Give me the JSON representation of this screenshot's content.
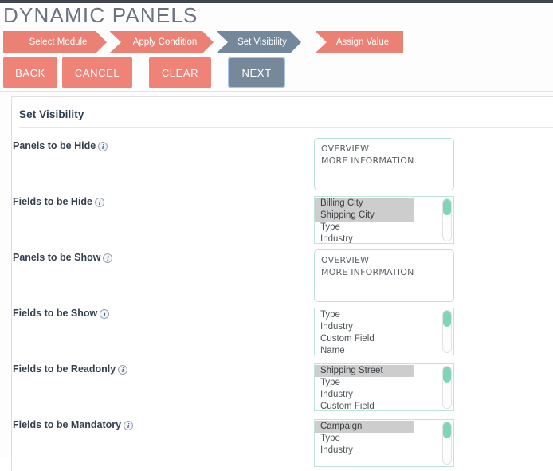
{
  "page": {
    "title": "DYNAMIC PANELS"
  },
  "wizard": {
    "steps": [
      {
        "label": "Select Module",
        "state": "done"
      },
      {
        "label": "Apply Condition",
        "state": "done"
      },
      {
        "label": "Set Visibility",
        "state": "active"
      },
      {
        "label": "Assign Value",
        "state": "todo"
      }
    ]
  },
  "toolbar": {
    "back_label": "BACK",
    "cancel_label": "CANCEL",
    "clear_label": "CLEAR",
    "next_label": "NEXT"
  },
  "card": {
    "title": "Set Visibility"
  },
  "fields": [
    {
      "label": "Panels to be Hide",
      "icon": "info-icon",
      "type": "panelbox",
      "options": [
        "OVERVIEW",
        "MORE INFORMATION"
      ],
      "selected": []
    },
    {
      "label": "Fields to be Hide",
      "icon": "info-icon",
      "type": "listbox",
      "options": [
        "Billing City",
        "Shipping City",
        "Type",
        "Industry"
      ],
      "selected": [
        "Billing City",
        "Shipping City"
      ]
    },
    {
      "label": "Panels to be Show",
      "icon": "info-icon",
      "type": "panelbox",
      "options": [
        "OVERVIEW",
        "MORE INFORMATION"
      ],
      "selected": []
    },
    {
      "label": "Fields to be Show",
      "icon": "info-icon",
      "type": "listbox",
      "options": [
        "Type",
        "Industry",
        "Custom Field",
        "Name"
      ],
      "selected": []
    },
    {
      "label": "Fields to be Readonly",
      "icon": "info-icon",
      "type": "listbox",
      "options": [
        "Shipping Street",
        "Type",
        "Industry",
        "Custom Field"
      ],
      "selected": [
        "Shipping Street"
      ]
    },
    {
      "label": "Fields to be Mandatory",
      "icon": "info-icon",
      "type": "listbox",
      "options": [
        "Campaign",
        "Type",
        "Industry"
      ],
      "selected": [
        "Campaign"
      ]
    }
  ],
  "colors": {
    "accent_coral": "#ef8377",
    "active_slate": "#74889b",
    "focus_blue": "#a8c6e8",
    "border_teal": "#bfe5d8",
    "scroll_thumb": "#7fd4ba",
    "selection_grey": "#cdcdcd",
    "topbar_dark": "#3f4652"
  },
  "layout": {
    "field_row_tops": [
      176,
      246,
      316,
      386,
      456,
      526
    ],
    "box_tops": [
      173,
      246,
      313,
      386,
      456,
      526
    ]
  }
}
